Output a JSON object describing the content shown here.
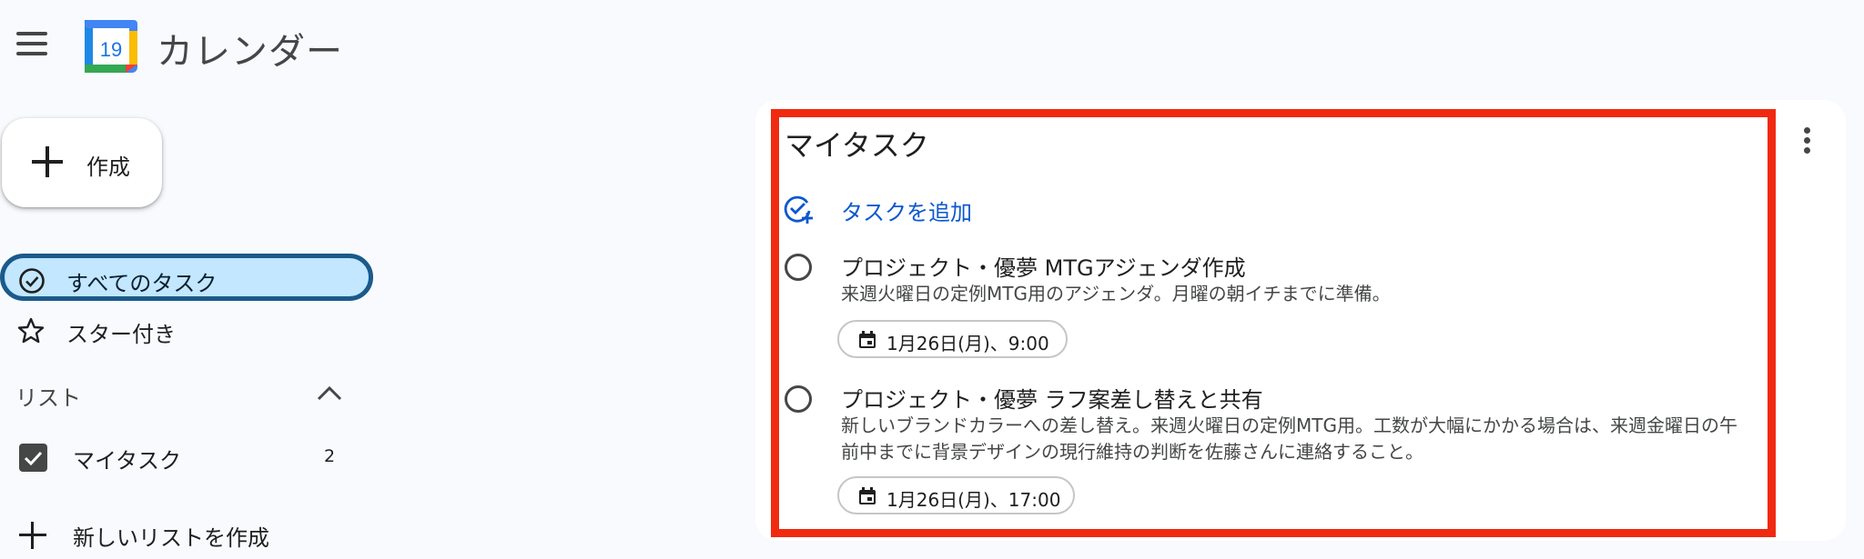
{
  "header": {
    "app_title": "カレンダー",
    "logo_day": "19",
    "menu_icon": "hamburger-menu-icon"
  },
  "sidebar": {
    "create_label": "作成",
    "nav": [
      {
        "label": "すべてのタスク",
        "icon": "check-circle-icon",
        "selected": true
      },
      {
        "label": "スター付き",
        "icon": "star-icon"
      }
    ],
    "lists_header": "リスト",
    "lists": [
      {
        "label": "マイタスク",
        "count": "2",
        "checked": true
      }
    ],
    "new_list_label": "新しいリストを作成"
  },
  "panel": {
    "title": "マイタスク",
    "add_task_label": "タスクを追加",
    "tasks": [
      {
        "title": "プロジェクト・優夢 MTGアジェンダ作成",
        "description": "来週火曜日の定例MTG用のアジェンダ。月曜の朝イチまでに準備。",
        "due": "1月26日(月)、9:00"
      },
      {
        "title": "プロジェクト・優夢 ラフ案差し替えと共有",
        "description": "新しいブランドカラーへの差し替え。来週火曜日の定例MTG用。工数が大幅にかかる場合は、来週金曜日の午前中までに背景デザインの現行維持の判断を佐藤さんに連絡すること。",
        "due": "1月26日(月)、17:00"
      }
    ]
  },
  "colors": {
    "accent": "#0b57d0",
    "selected_bg": "#c2e7ff",
    "highlight_border": "#f02a10"
  }
}
